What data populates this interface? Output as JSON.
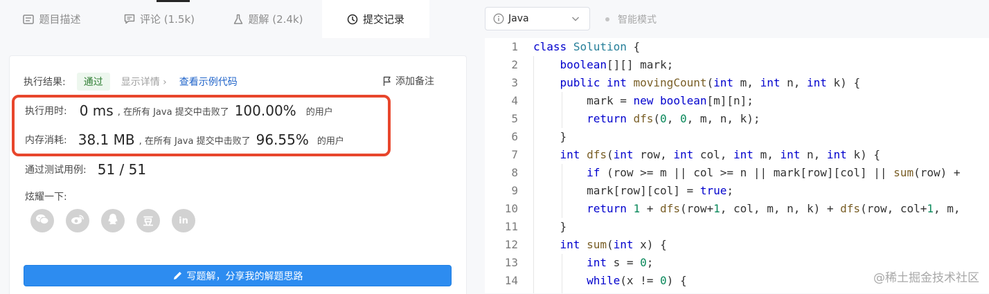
{
  "tabs": [
    {
      "label": "题目描述",
      "icon": "description-icon"
    },
    {
      "label": "评论 (1.5k)",
      "icon": "comment-icon"
    },
    {
      "label": "题解 (2.4k)",
      "icon": "flask-icon"
    },
    {
      "label": "提交记录",
      "icon": "clock-icon"
    }
  ],
  "result": {
    "label": "执行结果:",
    "status": "通过",
    "details": "显示详情",
    "example_code": "查看示例代码",
    "add_note": "添加备注"
  },
  "runtime": {
    "label": "执行用时:",
    "value": "0 ms",
    "mid": ", 在所有 Java 提交中击败了",
    "percent": "100.00%",
    "suffix": "的用户"
  },
  "memory": {
    "label": "内存消耗:",
    "value": "38.1 MB",
    "mid": ", 在所有 Java 提交中击败了",
    "percent": "96.55%",
    "suffix": "的用户"
  },
  "testcases": {
    "label": "通过测试用例:",
    "value": "51 / 51"
  },
  "share": {
    "label": "炫耀一下:",
    "icons": [
      "wechat-icon",
      "weibo-icon",
      "qq-icon",
      "douban-icon",
      "linkedin-icon"
    ],
    "douban_text": "豆",
    "linkedin_text": "in"
  },
  "solution_button": "写题解，分享我的解题思路",
  "editor": {
    "language": "Java",
    "smart_mode": "智能模式",
    "line_numbers": [
      "1",
      "2",
      "3",
      "4",
      "5",
      "6",
      "7",
      "8",
      "9",
      "10",
      "11",
      "12",
      "13",
      "14"
    ]
  },
  "watermark": "@稀土掘金技术社区",
  "colors": {
    "accent": "#2d8cf0",
    "highlight_box": "#e8462c",
    "pass": "#2e7d32",
    "link": "#1f63c9"
  }
}
